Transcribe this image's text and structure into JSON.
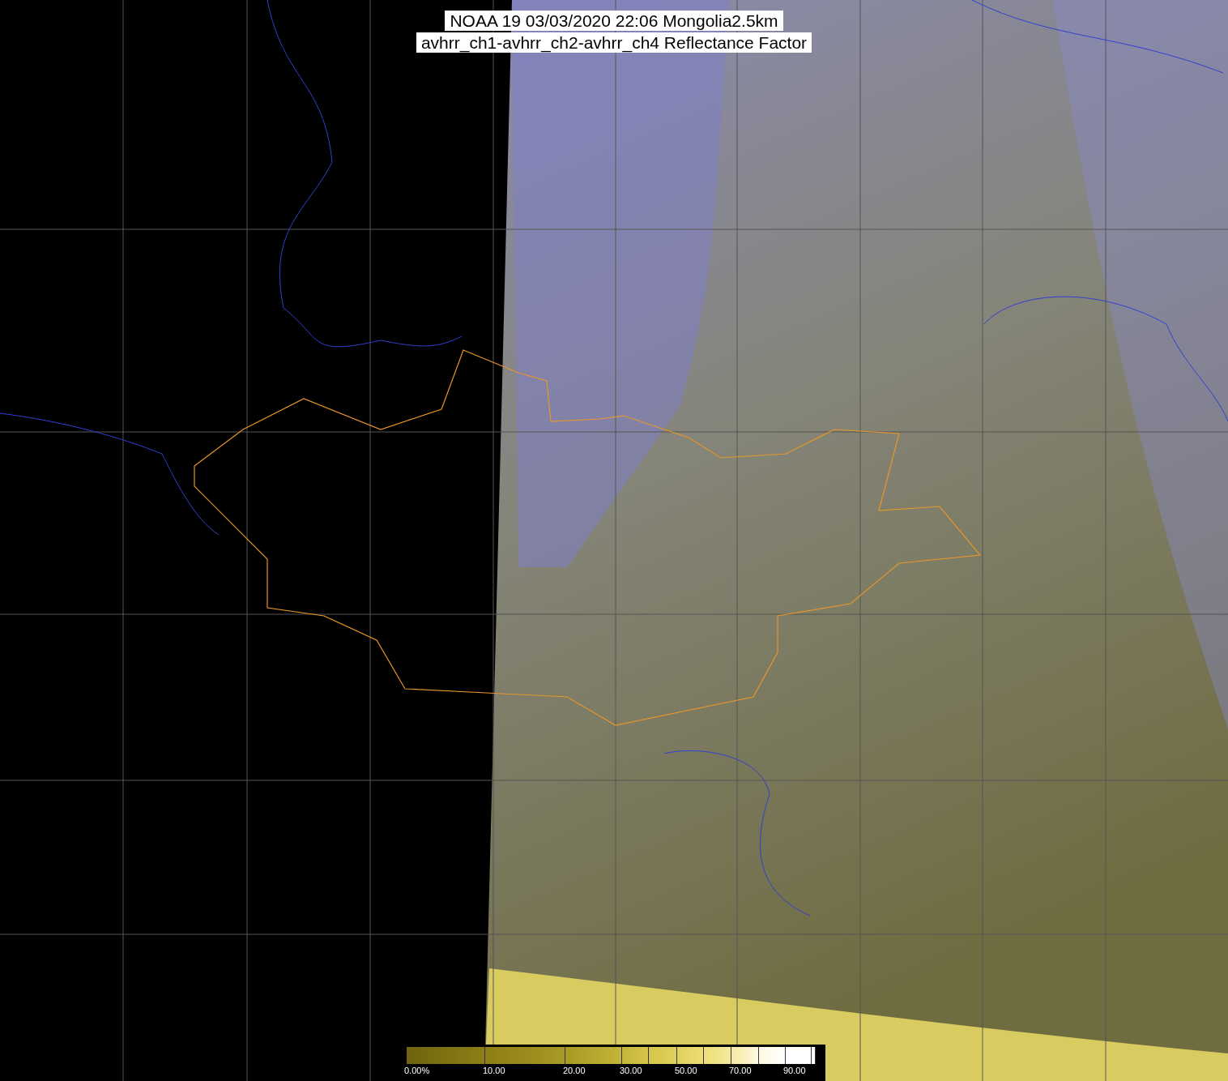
{
  "title": {
    "line_1": "NOAA 19 03/03/2020 22:06 Mongolia2.5km",
    "line_2": "avhrr_ch1-avhrr_ch2-avhrr_ch4 Reflectance Factor"
  },
  "colorbar": {
    "labels": [
      "0.00%",
      "10.00",
      "20.00",
      "30.00",
      "50.00",
      "70.00",
      "90.00"
    ]
  }
}
